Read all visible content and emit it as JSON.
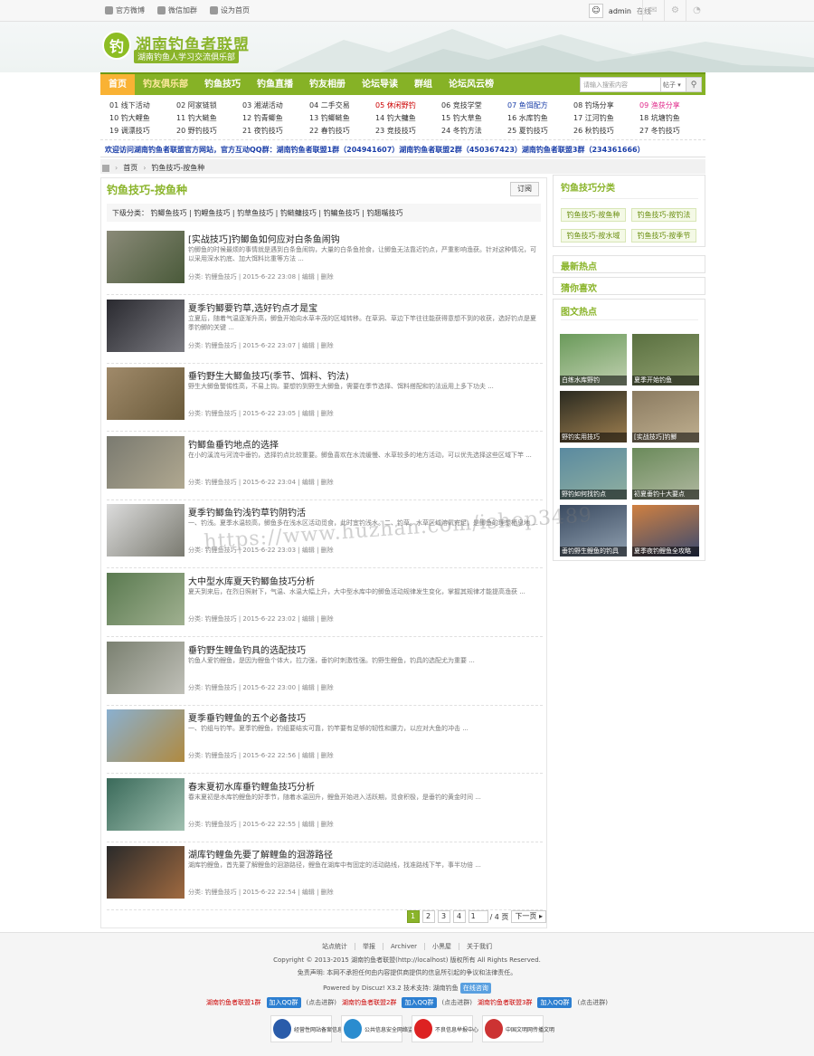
{
  "topbar": {
    "links": [
      "官方微博",
      "微信加群",
      "设为首页"
    ],
    "username": "admin",
    "online": "在线"
  },
  "header": {
    "title": "湖南钓鱼者联盟",
    "subtitle": "湖南钓鱼人学习交流俱乐部"
  },
  "nav": {
    "items": [
      "首页",
      "钓友俱乐部",
      "钓鱼技巧",
      "钓鱼直播",
      "钓友相册",
      "论坛导读",
      "群组",
      "论坛风云榜"
    ],
    "search_placeholder": "请输入搜索内容",
    "search_type": "帖子"
  },
  "subgrid": [
    [
      "01 线下活动",
      "02 阿家链锁",
      "03 湘湖活动",
      "04 二手交易",
      "05 休闲野钓",
      "06 竞技学堂",
      "07 鱼饵配方",
      "08 钓场分享",
      "09 渔获分享"
    ],
    [
      "10 钓大鲤鱼",
      "11 钓大鲢鱼",
      "12 钓青鲫鱼",
      "13 钓鲫鲢鱼",
      "14 钓大鳙鱼",
      "15 钓大草鱼",
      "16 水库钓鱼",
      "17 江河钓鱼",
      "18 坑塘钓鱼"
    ],
    [
      "19 调漂技巧",
      "20 野钓技巧",
      "21 夜钓技巧",
      "22 春钓技巧",
      "23 竞技技巧",
      "24 冬钓方法",
      "25 夏钓技巧",
      "26 秋钓技巧",
      "27 冬钓技巧"
    ]
  ],
  "notice": "欢迎访问湖南钓鱼者联盟官方网站，官方互动QQ群：湖南钓鱼者联盟1群（204941607）湖南钓鱼者联盟2群（450367423）湖南钓鱼者联盟3群（234361666）",
  "breadcrumb": [
    "首页",
    "钓鱼技巧-按鱼种"
  ],
  "main": {
    "title": "钓鱼技巧-按鱼种",
    "subscribe": "订阅",
    "subcats_label": "下级分类：",
    "subcats": [
      "钓鲫鱼技巧",
      "钓鲤鱼技巧",
      "钓草鱼技巧",
      "钓鲢鳙技巧",
      "钓鳊鱼技巧",
      "钓翘嘴技巧"
    ],
    "meta_prefix": "分类: 钓鲤鱼技巧",
    "edit": "编辑",
    "del": "删除",
    "posts": [
      {
        "title": "[实战技巧]钓鲫鱼如何应对白条鱼闹钩",
        "desc": "钓鲫鱼的时候最烦的事情就是遇到白条鱼闹钩，大量的白条鱼抢食，让鲫鱼无法靠近钓点，严重影响渔获。针对这种情况，可以采用深水钓底、加大饵料比重等方法 ...",
        "date": "2015-6-22 23:08"
      },
      {
        "title": "夏季钓鲫要钓草,选好钓点才是宝",
        "desc": "立夏后，随着气温逐渐升高，鲫鱼开始向水草丰茂的区域转移。在草洞、草边下竿往往能获得意想不到的收获，选好钓点是夏季钓鲫的关键 ...",
        "date": "2015-6-22 23:07"
      },
      {
        "title": "垂钓野生大鲫鱼技巧(季节、饵料、钓法)",
        "desc": "野生大鲫鱼警惕性高，不易上钩。要想钓到野生大鲫鱼，需要在季节选择、饵料搭配和钓法运用上多下功夫 ...",
        "date": "2015-6-22 23:05"
      },
      {
        "title": "钓鲫鱼垂钓地点的选择",
        "desc": "在小的溪流与河流中垂钓，选择钓点比较重要。鲫鱼喜欢在水流缓慢、水草较多的地方活动，可以优先选择这些区域下竿 ...",
        "date": "2015-6-22 23:04"
      },
      {
        "title": "夏季钓鲫鱼钓浅钓草钓阴钓活",
        "desc": "一、钓浅。夏季水温较高，鲫鱼多在浅水区活动觅食，此时宜钓浅水。二、钓草。水草区域溶氧充足，是鲫鱼的理想栖息地 ...",
        "date": "2015-6-22 23:03"
      },
      {
        "title": "大中型水库夏天钓鲫鱼技巧分析",
        "desc": "夏天到来后，在烈日照射下，气温、水温大幅上升，大中型水库中的鲫鱼活动规律发生变化，掌握其规律才能提高渔获 ...",
        "date": "2015-6-22 23:02"
      },
      {
        "title": "垂钓野生鲤鱼钓具的选配技巧",
        "desc": "钓鱼人爱钓鲤鱼，是因为鲤鱼个体大，拉力强，垂钓时刺激性强。钓野生鲤鱼，钓具的选配尤为重要 ...",
        "date": "2015-6-22 23:00"
      },
      {
        "title": "夏季垂钓鲤鱼的五个必备技巧",
        "desc": "一、钓组与钓竿。夏季钓鲤鱼，钓组要结实可靠，钓竿要有足够的韧性和腰力，以应对大鱼的冲击 ...",
        "date": "2015-6-22 22:56"
      },
      {
        "title": "春末夏初水库垂钓鲤鱼技巧分析",
        "desc": "春末夏初是水库钓鲤鱼的好季节，随着水温回升，鲤鱼开始进入活跃期，觅食积极，是垂钓的黄金时间 ...",
        "date": "2015-6-22 22:55"
      },
      {
        "title": "湖库钓鲤鱼先要了解鲤鱼的洄游路径",
        "desc": "湖库钓鲤鱼，首先要了解鲤鱼的洄游路径，鲤鱼在湖库中有固定的活动路线，找准路线下竿，事半功倍 ...",
        "date": "2015-6-22 22:54"
      }
    ]
  },
  "pager": {
    "pages": [
      "1",
      "2",
      "3",
      "4"
    ],
    "jump_value": "1",
    "total": "/ 4 页",
    "next": "下一页"
  },
  "sidebar": {
    "box1_title": "钓鱼技巧分类",
    "tags": [
      "钓鱼技巧-按鱼种",
      "钓鱼技巧-按钓法",
      "钓鱼技巧-按水域",
      "钓鱼技巧-按季节"
    ],
    "hot_title": "最新热点",
    "like_title": "猜你喜欢",
    "pic_title": "图文热点",
    "pics": [
      "白练水库野钓",
      "夏季开始钓鱼",
      "野钓实用技巧",
      "[实战技巧]钓鲫",
      "野钓如何找钓点",
      "初夏垂钓十大要点",
      "垂钓野生鲤鱼的钓具",
      "夏季夜钓鲤鱼全攻略"
    ]
  },
  "watermark": "https://www.huzhan.com/ishop3489",
  "footer": {
    "links": [
      "站点统计",
      "举报",
      "Archiver",
      "小黑屋",
      "关于我们"
    ],
    "copyright": "Copyright © 2013-2015 湖南钓鱼者联盟(http://localhost) 版权所有 All Rights Reserved.",
    "disclaimer": "免责声明: 本网不承担任何由内容提供商提供的信息所引起的争议和法律责任。",
    "powered": "Powered by Discuz! X3.2 技术支持: 湖南钓鱼",
    "online_service": "在线咨询",
    "qq_groups": [
      "湖南钓鱼者联盟1群",
      "湖南钓鱼者联盟2群",
      "湖南钓鱼者联盟3群"
    ],
    "qq_join": "加入QQ群",
    "qq_click": "(点击进群)",
    "badges": [
      "经营性网站备案信息",
      "公共信息安全网络监察",
      "不良信息举报中心",
      "中国文明网传播文明"
    ]
  }
}
